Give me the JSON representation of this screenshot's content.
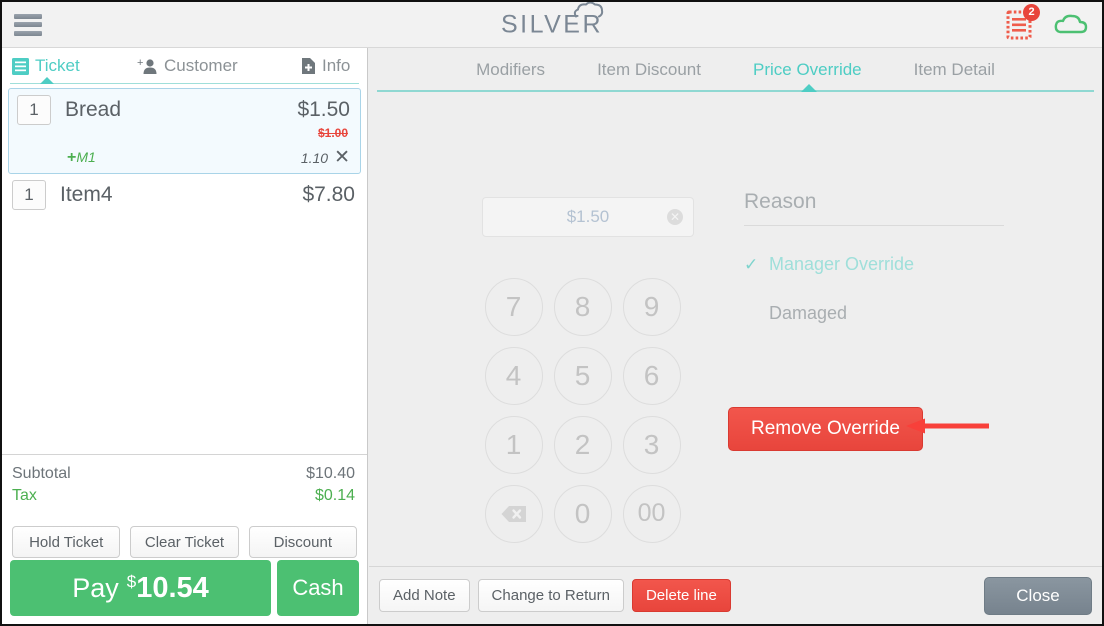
{
  "header": {
    "menu_icon": "hamburger-icon",
    "logo_text": "SILVER",
    "logo_mark": "cloud-icon",
    "receipt_icon": "receipt-icon",
    "receipt_badge": "2",
    "cloud_icon": "cloud-sync-icon"
  },
  "left_panel": {
    "tabs": [
      {
        "label": "Ticket",
        "icon": "list-icon",
        "active": true
      },
      {
        "label": "Customer",
        "icon": "add-person-icon",
        "active": false
      },
      {
        "label": "Info",
        "icon": "add-document-icon",
        "active": false
      }
    ],
    "items": [
      {
        "qty": "1",
        "name": "Bread",
        "price": "$1.50",
        "struck_price": "$1.00",
        "modifier": "M1",
        "modifier_plus": "+",
        "sub_amount": "1.10",
        "remove_icon": "close-icon",
        "selected": true
      },
      {
        "qty": "1",
        "name": "Item4",
        "price": "$7.80",
        "selected": false
      }
    ],
    "totals": [
      {
        "label": "Subtotal",
        "value": "$10.40",
        "kind": "normal"
      },
      {
        "label": "Tax",
        "value": "$0.14",
        "kind": "tax"
      }
    ],
    "mini_buttons": [
      "Hold Ticket",
      "Clear Ticket",
      "Discount"
    ],
    "pay": {
      "word": "Pay",
      "currency": "$",
      "amount": "10.54"
    },
    "cash_label": "Cash"
  },
  "right_panel": {
    "tabs": [
      {
        "label": "Modifiers",
        "active": false
      },
      {
        "label": "Item Discount",
        "active": false
      },
      {
        "label": "Price Override",
        "active": true
      },
      {
        "label": "Item Detail",
        "active": false
      }
    ],
    "price_input": {
      "value": "$1.50",
      "clear_icon": "clear-circle-icon"
    },
    "keypad": [
      "7",
      "8",
      "9",
      "4",
      "5",
      "6",
      "1",
      "2",
      "3",
      "⌫",
      "0",
      "00"
    ],
    "reason": {
      "label": "Reason",
      "options": [
        {
          "label": "Manager Override",
          "selected": true
        },
        {
          "label": "Damaged",
          "selected": false
        }
      ]
    },
    "remove_override_label": "Remove Override",
    "annotation_arrow": "red-left-arrow",
    "footer_buttons": [
      {
        "label": "Add Note",
        "style": "default"
      },
      {
        "label": "Change to Return",
        "style": "default"
      },
      {
        "label": "Delete line",
        "style": "danger"
      }
    ],
    "close_label": "Close"
  },
  "colors": {
    "accent_teal": "#4ecdc4",
    "pay_green": "#4cc072",
    "danger_red": "#e8453c",
    "receipt_orange": "#ef5c4b",
    "cloud_green": "#4cc072",
    "selected_row_bg": "#f3fafe",
    "panel_bg": "#eeeeee"
  }
}
